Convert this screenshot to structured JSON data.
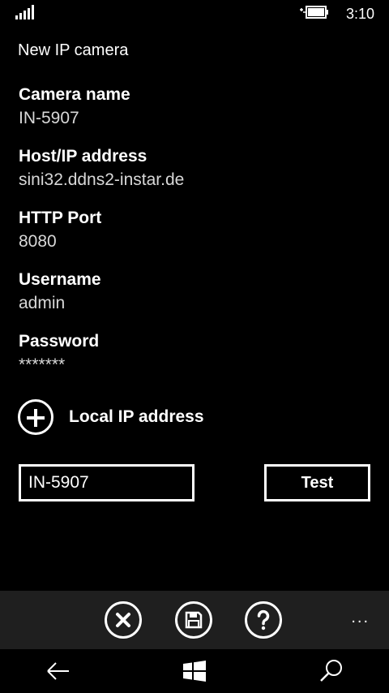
{
  "status_bar": {
    "time": "3:10"
  },
  "page": {
    "title": "New IP camera"
  },
  "fields": [
    {
      "label": "Camera name",
      "value": "IN-5907"
    },
    {
      "label": "Host/IP address",
      "value": "sini32.ddns2-instar.de"
    },
    {
      "label": "HTTP Port",
      "value": "8080"
    },
    {
      "label": "Username",
      "value": "admin"
    },
    {
      "label": "Password",
      "value": "*******"
    }
  ],
  "local_ip": {
    "label": "Local IP address"
  },
  "test_row": {
    "input_value": "IN-5907",
    "button_label": "Test"
  },
  "app_bar": {
    "buttons": [
      "cancel-icon",
      "save-icon",
      "help-icon"
    ],
    "more_label": "..."
  },
  "nav_bar": {
    "icons": [
      "back-arrow-icon",
      "windows-icon",
      "search-icon"
    ]
  },
  "colors": {
    "background": "#000000",
    "app_bar": "#1f1f1f",
    "foreground": "#ffffff"
  }
}
